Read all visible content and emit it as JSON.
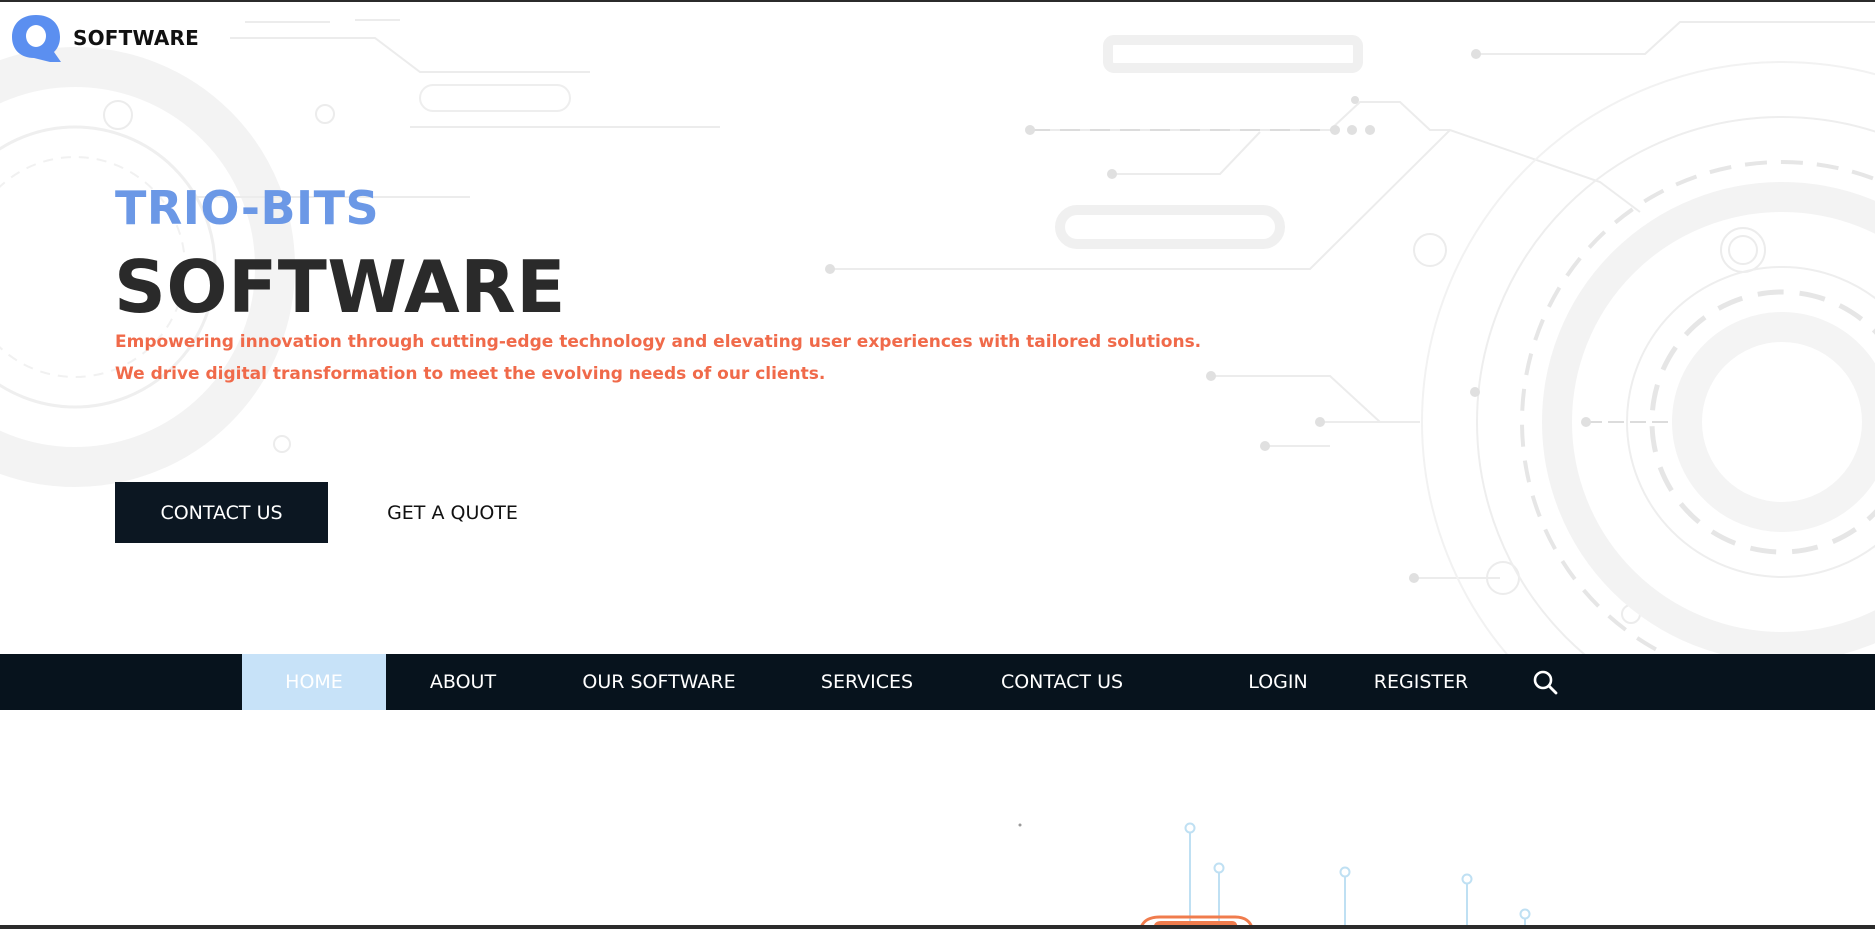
{
  "logo": {
    "text": "SOFTWARE",
    "icon": "q-logo-icon",
    "color": "#5b8ff0"
  },
  "hero": {
    "kicker": "TRIO-BITS",
    "title": "SOFTWARE",
    "description_lines": [
      "Empowering innovation through cutting-edge technology and elevating user experiences with tailored solutions.",
      "We drive digital transformation to meet the evolving needs of our clients."
    ],
    "primary_button": "CONTACT US",
    "secondary_button": "GET A QUOTE",
    "colors": {
      "kicker": "#6b98e6",
      "title": "#2a2a2a",
      "description": "#f06a4a",
      "button_bg": "#0c1722"
    }
  },
  "nav": {
    "items": [
      {
        "label": "HOME",
        "active": true
      },
      {
        "label": "ABOUT",
        "active": false
      },
      {
        "label": "OUR SOFTWARE",
        "active": false
      },
      {
        "label": "SERVICES",
        "active": false
      },
      {
        "label": "CONTACT US",
        "active": false
      },
      {
        "label": "LOGIN",
        "active": false
      },
      {
        "label": "REGISTER",
        "active": false
      }
    ],
    "search_icon": "search-icon",
    "colors": {
      "background": "#07131d",
      "active_background": "#c7e2f8"
    }
  }
}
